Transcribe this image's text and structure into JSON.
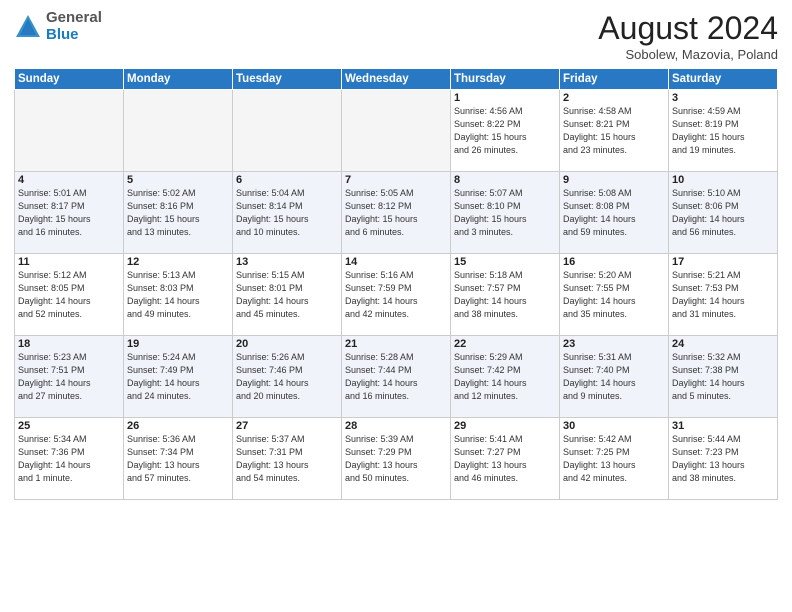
{
  "header": {
    "logo_general": "General",
    "logo_blue": "Blue",
    "month_title": "August 2024",
    "location": "Sobolew, Mazovia, Poland"
  },
  "days_of_week": [
    "Sunday",
    "Monday",
    "Tuesday",
    "Wednesday",
    "Thursday",
    "Friday",
    "Saturday"
  ],
  "weeks": [
    {
      "row_class": "week-row-1",
      "days": [
        {
          "num": "",
          "info": "",
          "empty": true
        },
        {
          "num": "",
          "info": "",
          "empty": true
        },
        {
          "num": "",
          "info": "",
          "empty": true
        },
        {
          "num": "",
          "info": "",
          "empty": true
        },
        {
          "num": "1",
          "info": "Sunrise: 4:56 AM\nSunset: 8:22 PM\nDaylight: 15 hours\nand 26 minutes.",
          "empty": false
        },
        {
          "num": "2",
          "info": "Sunrise: 4:58 AM\nSunset: 8:21 PM\nDaylight: 15 hours\nand 23 minutes.",
          "empty": false
        },
        {
          "num": "3",
          "info": "Sunrise: 4:59 AM\nSunset: 8:19 PM\nDaylight: 15 hours\nand 19 minutes.",
          "empty": false
        }
      ]
    },
    {
      "row_class": "week-row-2",
      "days": [
        {
          "num": "4",
          "info": "Sunrise: 5:01 AM\nSunset: 8:17 PM\nDaylight: 15 hours\nand 16 minutes.",
          "empty": false
        },
        {
          "num": "5",
          "info": "Sunrise: 5:02 AM\nSunset: 8:16 PM\nDaylight: 15 hours\nand 13 minutes.",
          "empty": false
        },
        {
          "num": "6",
          "info": "Sunrise: 5:04 AM\nSunset: 8:14 PM\nDaylight: 15 hours\nand 10 minutes.",
          "empty": false
        },
        {
          "num": "7",
          "info": "Sunrise: 5:05 AM\nSunset: 8:12 PM\nDaylight: 15 hours\nand 6 minutes.",
          "empty": false
        },
        {
          "num": "8",
          "info": "Sunrise: 5:07 AM\nSunset: 8:10 PM\nDaylight: 15 hours\nand 3 minutes.",
          "empty": false
        },
        {
          "num": "9",
          "info": "Sunrise: 5:08 AM\nSunset: 8:08 PM\nDaylight: 14 hours\nand 59 minutes.",
          "empty": false
        },
        {
          "num": "10",
          "info": "Sunrise: 5:10 AM\nSunset: 8:06 PM\nDaylight: 14 hours\nand 56 minutes.",
          "empty": false
        }
      ]
    },
    {
      "row_class": "week-row-3",
      "days": [
        {
          "num": "11",
          "info": "Sunrise: 5:12 AM\nSunset: 8:05 PM\nDaylight: 14 hours\nand 52 minutes.",
          "empty": false
        },
        {
          "num": "12",
          "info": "Sunrise: 5:13 AM\nSunset: 8:03 PM\nDaylight: 14 hours\nand 49 minutes.",
          "empty": false
        },
        {
          "num": "13",
          "info": "Sunrise: 5:15 AM\nSunset: 8:01 PM\nDaylight: 14 hours\nand 45 minutes.",
          "empty": false
        },
        {
          "num": "14",
          "info": "Sunrise: 5:16 AM\nSunset: 7:59 PM\nDaylight: 14 hours\nand 42 minutes.",
          "empty": false
        },
        {
          "num": "15",
          "info": "Sunrise: 5:18 AM\nSunset: 7:57 PM\nDaylight: 14 hours\nand 38 minutes.",
          "empty": false
        },
        {
          "num": "16",
          "info": "Sunrise: 5:20 AM\nSunset: 7:55 PM\nDaylight: 14 hours\nand 35 minutes.",
          "empty": false
        },
        {
          "num": "17",
          "info": "Sunrise: 5:21 AM\nSunset: 7:53 PM\nDaylight: 14 hours\nand 31 minutes.",
          "empty": false
        }
      ]
    },
    {
      "row_class": "week-row-4",
      "days": [
        {
          "num": "18",
          "info": "Sunrise: 5:23 AM\nSunset: 7:51 PM\nDaylight: 14 hours\nand 27 minutes.",
          "empty": false
        },
        {
          "num": "19",
          "info": "Sunrise: 5:24 AM\nSunset: 7:49 PM\nDaylight: 14 hours\nand 24 minutes.",
          "empty": false
        },
        {
          "num": "20",
          "info": "Sunrise: 5:26 AM\nSunset: 7:46 PM\nDaylight: 14 hours\nand 20 minutes.",
          "empty": false
        },
        {
          "num": "21",
          "info": "Sunrise: 5:28 AM\nSunset: 7:44 PM\nDaylight: 14 hours\nand 16 minutes.",
          "empty": false
        },
        {
          "num": "22",
          "info": "Sunrise: 5:29 AM\nSunset: 7:42 PM\nDaylight: 14 hours\nand 12 minutes.",
          "empty": false
        },
        {
          "num": "23",
          "info": "Sunrise: 5:31 AM\nSunset: 7:40 PM\nDaylight: 14 hours\nand 9 minutes.",
          "empty": false
        },
        {
          "num": "24",
          "info": "Sunrise: 5:32 AM\nSunset: 7:38 PM\nDaylight: 14 hours\nand 5 minutes.",
          "empty": false
        }
      ]
    },
    {
      "row_class": "week-row-5",
      "days": [
        {
          "num": "25",
          "info": "Sunrise: 5:34 AM\nSunset: 7:36 PM\nDaylight: 14 hours\nand 1 minute.",
          "empty": false
        },
        {
          "num": "26",
          "info": "Sunrise: 5:36 AM\nSunset: 7:34 PM\nDaylight: 13 hours\nand 57 minutes.",
          "empty": false
        },
        {
          "num": "27",
          "info": "Sunrise: 5:37 AM\nSunset: 7:31 PM\nDaylight: 13 hours\nand 54 minutes.",
          "empty": false
        },
        {
          "num": "28",
          "info": "Sunrise: 5:39 AM\nSunset: 7:29 PM\nDaylight: 13 hours\nand 50 minutes.",
          "empty": false
        },
        {
          "num": "29",
          "info": "Sunrise: 5:41 AM\nSunset: 7:27 PM\nDaylight: 13 hours\nand 46 minutes.",
          "empty": false
        },
        {
          "num": "30",
          "info": "Sunrise: 5:42 AM\nSunset: 7:25 PM\nDaylight: 13 hours\nand 42 minutes.",
          "empty": false
        },
        {
          "num": "31",
          "info": "Sunrise: 5:44 AM\nSunset: 7:23 PM\nDaylight: 13 hours\nand 38 minutes.",
          "empty": false
        }
      ]
    }
  ]
}
